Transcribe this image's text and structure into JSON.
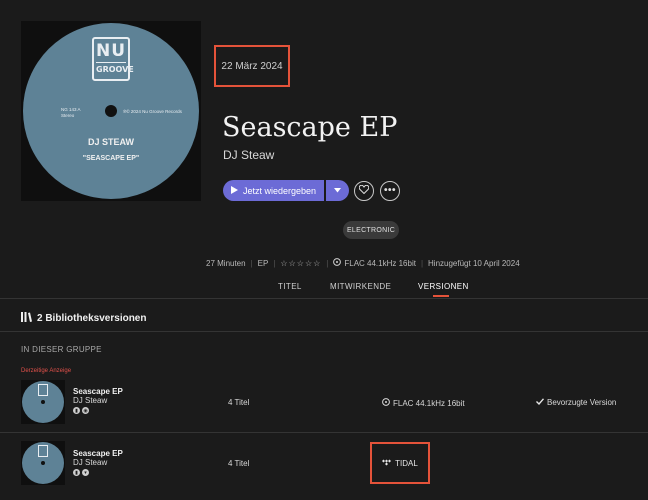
{
  "album": {
    "release_date": "22 März 2024",
    "title": "Seascape EP",
    "artist": "DJ Steaw",
    "cover": {
      "logo_top": "NU",
      "logo_bottom": "GROOVE",
      "catalog": "NG 143 A",
      "channels": "Stereo",
      "copyright": "℗© 2024 Nu Groove Records",
      "artist": "DJ STEAW",
      "title": "\"SEASCAPE EP\""
    }
  },
  "actions": {
    "play_label": "Jetzt wiedergeben",
    "play_icon": "play-icon",
    "dropdown_icon": "chevron-down-icon",
    "favorite_icon": "heart-icon",
    "more_icon": "ellipsis-icon"
  },
  "genre": "ELECTRONIC",
  "meta": {
    "duration": "27 Minuten",
    "type": "EP",
    "rating": "☆☆☆☆☆",
    "format": "FLAC 44.1kHz 16bit",
    "added": "Hinzugefügt 10 April 2024"
  },
  "tabs": [
    "TITEL",
    "MITWIRKENDE",
    "VERSIONEN"
  ],
  "active_tab": "VERSIONEN",
  "versions": {
    "heading": "2 Bibliotheksversionen",
    "group_label": "IN DIESER GRUPPE",
    "current_label": "Derzeitige Anzeige",
    "rows": [
      {
        "title": "Seascape EP",
        "artist": "DJ Steaw",
        "tracks": "4 Titel",
        "source": "FLAC 44.1kHz 16bit",
        "status": "Bevorzugte Version"
      },
      {
        "title": "Seascape EP",
        "artist": "DJ Steaw",
        "tracks": "4 Titel",
        "source": "TIDAL",
        "status": ""
      }
    ]
  },
  "colors": {
    "accent": "#6c6bd6",
    "highlight": "#e5533a",
    "background": "#1b1b1b"
  }
}
